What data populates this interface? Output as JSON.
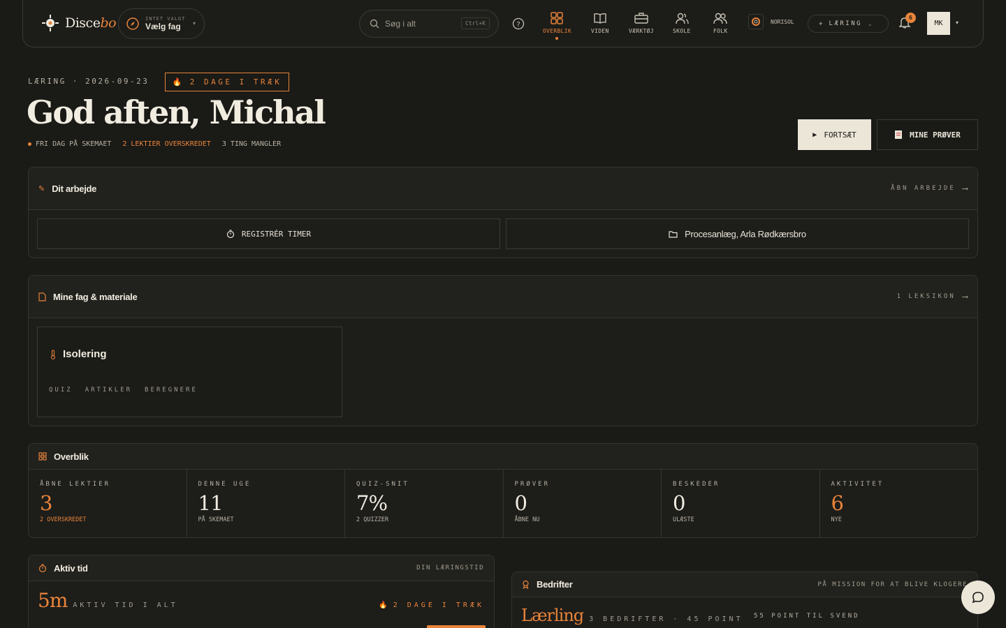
{
  "brand": {
    "name_main": "Disce",
    "name_accent": "bo"
  },
  "subject_picker": {
    "hint": "INTET VALGT",
    "label": "Vælg fag"
  },
  "search": {
    "placeholder": "Søg i alt",
    "shortcut": "Ctrl+K"
  },
  "nav": [
    {
      "label": "OVERBLIK",
      "icon": "grid-icon",
      "active": true
    },
    {
      "label": "VIDEN",
      "icon": "book-icon",
      "active": false
    },
    {
      "label": "VÆRKTØJ",
      "icon": "briefcase-icon",
      "active": false
    },
    {
      "label": "SKOLE",
      "icon": "users-icon",
      "active": false
    },
    {
      "label": "FOLK",
      "icon": "people-icon",
      "active": false
    }
  ],
  "org": {
    "name": "NORISOL"
  },
  "mode": {
    "label": "LÆRING"
  },
  "notifications": {
    "count": "6"
  },
  "user": {
    "initials": "MK"
  },
  "header": {
    "crumb": "LÆRING · 2026-09-23",
    "streak": "2 DAGE I TRÆK",
    "greeting": "God aften, Michal",
    "status_free": "FRI DAG PÅ SKEMAET",
    "status_overdue": "2 LEKTIER OVERSKREDET",
    "status_missing": "3 TING MANGLER"
  },
  "actions": {
    "continue": "FORTSÆT",
    "my_exams": "MINE PRØVER"
  },
  "work": {
    "title": "Dit arbejde",
    "link": "ÅBN ARBEJDE",
    "register": "REGISTRÉR TIMER",
    "project": "Procesanlæg, Arla Rødkærsbro"
  },
  "subjects": {
    "title": "Mine fag & materiale",
    "link": "1 LEKSIKON",
    "tile": {
      "name": "Isolering",
      "tags": [
        "QUIZ",
        "ARTIKLER",
        "BEREGNERE"
      ]
    }
  },
  "overview": {
    "title": "Overblik",
    "stats": [
      {
        "key": "ÅBNE LEKTIER",
        "value": "3",
        "sub": "2 OVERSKREDET"
      },
      {
        "key": "DENNE UGE",
        "value": "11",
        "sub": "PÅ SKEMAET"
      },
      {
        "key": "QUIZ-SNIT",
        "value": "7%",
        "sub": "2 QUIZZER"
      },
      {
        "key": "PRØVER",
        "value": "0",
        "sub": "ÅBNE NU"
      },
      {
        "key": "BESKEDER",
        "value": "0",
        "sub": "ULÆSTE"
      },
      {
        "key": "AKTIVITET",
        "value": "6",
        "sub": "NYE"
      }
    ]
  },
  "active_time": {
    "title": "Aktiv tid",
    "tag": "DIN LÆRINGSTID",
    "value": "5m",
    "label": "AKTIV TID I ALT",
    "streak": "2 DAGE I TRÆK"
  },
  "achievements": {
    "title": "Bedrifter",
    "tag": "PÅ MISSION FOR AT BLIVE KLOGERE",
    "level": "Lærling",
    "summary": "3 BEDRIFTER · 45 POINT",
    "next": "55 POINT TIL SVEND"
  },
  "colors": {
    "accent": "#e8843a",
    "background": "#1a1a17",
    "surface": "#1d1d1a",
    "cream": "#ece6d8"
  }
}
